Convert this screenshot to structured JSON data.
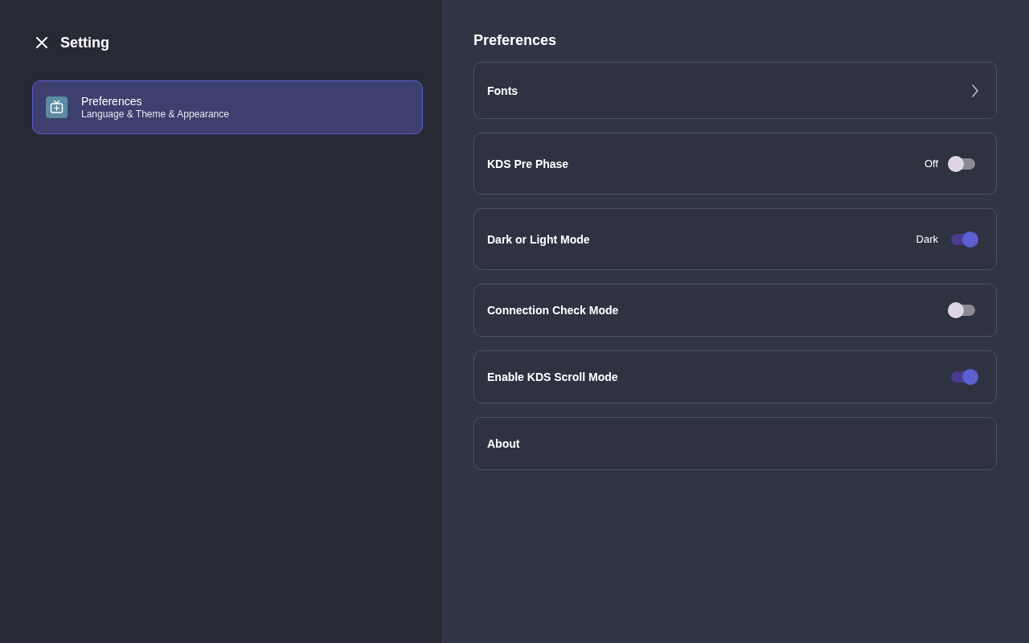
{
  "sidebar": {
    "title": "Setting",
    "items": [
      {
        "label": "Preferences",
        "subtitle": "Language & Theme & Appearance",
        "selected": true
      }
    ]
  },
  "content": {
    "title": "Preferences",
    "items": [
      {
        "kind": "link",
        "label": "Fonts"
      },
      {
        "kind": "toggle",
        "label": "KDS Pre Phase",
        "value": "Off",
        "on": false
      },
      {
        "kind": "toggle",
        "label": "Dark or Light Mode",
        "value": "Dark",
        "on": true
      },
      {
        "kind": "toggle",
        "label": "Connection Check Mode",
        "on": false
      },
      {
        "kind": "toggle",
        "label": "Enable KDS Scroll Mode",
        "on": true
      },
      {
        "kind": "plain",
        "label": "About"
      }
    ]
  }
}
